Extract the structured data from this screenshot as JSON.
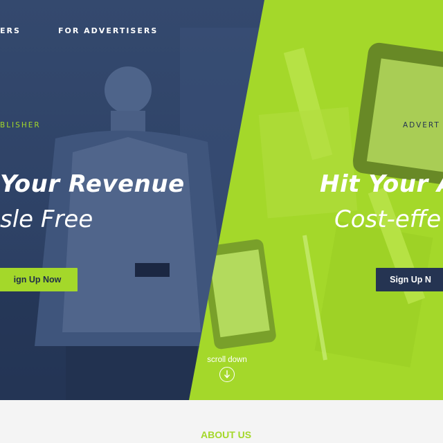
{
  "nav": {
    "item_publishers": "ERS",
    "item_advertisers": "FOR ADVERTISERS"
  },
  "publisher": {
    "label": "BLISHER",
    "headline_line1": "Your Revenue",
    "headline_line2": "sle Free",
    "button_label": "ign Up Now"
  },
  "advertiser": {
    "label": "ADVERT",
    "headline_line1": "Hit Your A",
    "headline_line2": "Cost-effe",
    "button_label": "Sign Up N"
  },
  "scroll": {
    "label": "scroll down"
  },
  "about": {
    "title": "ABOUT US"
  },
  "colors": {
    "navy": "#2e4266",
    "lime": "#a4d82a",
    "dark_button": "#253452"
  }
}
